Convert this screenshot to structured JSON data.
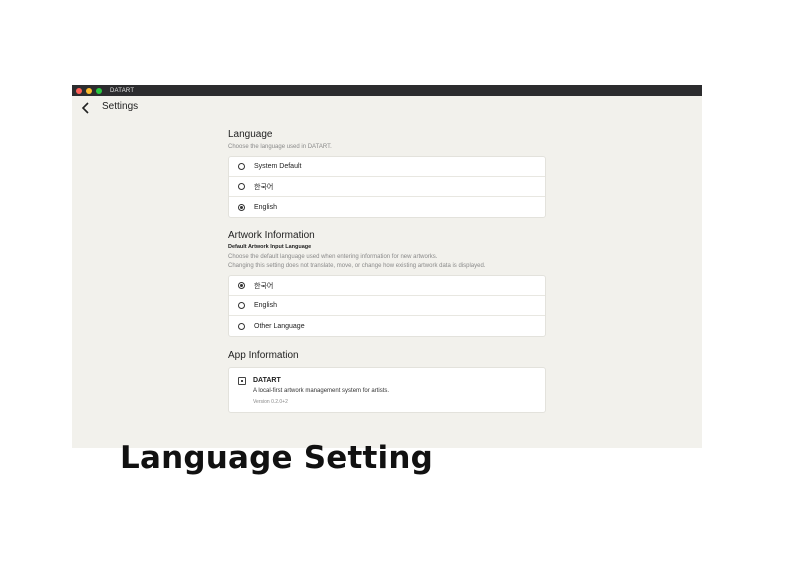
{
  "window": {
    "app_name": "DATART"
  },
  "header": {
    "title": "Settings"
  },
  "language": {
    "title": "Language",
    "description": "Choose the language used in DATART.",
    "options": [
      {
        "label": "System Default",
        "selected": false
      },
      {
        "label": "한국어",
        "selected": false
      },
      {
        "label": "English",
        "selected": true
      }
    ]
  },
  "artwork": {
    "title": "Artwork Information",
    "subtitle": "Default Artwork Input Language",
    "description_1": "Choose the default language used when entering information for new artworks.",
    "description_2": "Changing this setting does not translate, move, or change how existing artwork data is displayed.",
    "options": [
      {
        "label": "한국어",
        "selected": true
      },
      {
        "label": "English",
        "selected": false
      },
      {
        "label": "Other Language",
        "selected": false
      }
    ]
  },
  "app_info": {
    "title": "App Information",
    "name": "DATART",
    "description": "A local-first artwork management system for artists.",
    "version": "Version 0.2.0+2"
  },
  "caption": "Language Setting",
  "colors": {
    "window_bg": "#f2f1ec",
    "titlebar_bg": "#2c2c2e",
    "card_bg": "#ffffff"
  }
}
